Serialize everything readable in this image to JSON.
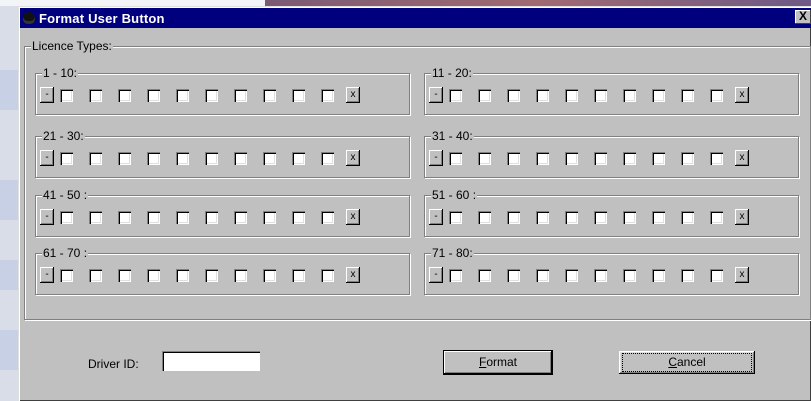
{
  "dialog": {
    "title": "Format User Button",
    "close_label": "X"
  },
  "licence_types": {
    "label": "Licence Types:",
    "ranges": [
      {
        "label": "1 - 10:",
        "minus": "-",
        "plus": "x"
      },
      {
        "label": "11 - 20:",
        "minus": "-",
        "plus": "x"
      },
      {
        "label": "21 - 30:",
        "minus": "-",
        "plus": "x"
      },
      {
        "label": "31 - 40:",
        "minus": "-",
        "plus": "x"
      },
      {
        "label": "41 - 50 :",
        "minus": "-",
        "plus": "x"
      },
      {
        "label": "51 - 60 :",
        "minus": "-",
        "plus": "x"
      },
      {
        "label": "61 - 70 :",
        "minus": "-",
        "plus": "x"
      },
      {
        "label": "71 - 80:",
        "minus": "-",
        "plus": "x"
      }
    ]
  },
  "driver": {
    "label": "Driver ID:",
    "value": ""
  },
  "buttons": {
    "format": {
      "accel": "F",
      "rest": "ormat"
    },
    "cancel": {
      "accel": "C",
      "rest": "ancel"
    }
  }
}
